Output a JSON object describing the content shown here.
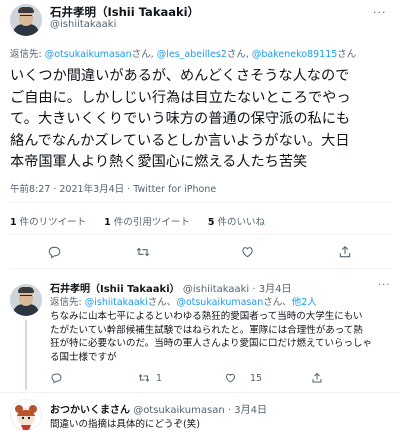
{
  "main_tweet": {
    "author_name": "石井孝明（Ishii Takaaki）",
    "author_handle": "@ishiitakaaki",
    "replying_prefix": "返信先: ",
    "replying_to": [
      "@otsukaikumasan",
      "@les_abeilles2",
      "@bakeneko89115"
    ],
    "replying_sep": "さん, ",
    "replying_suffix": "さん",
    "text": "いくつか間違いがあるが、めんどくさそうな人なので\nご自由に。しかしじい行為は目立たないところでやっ\nて。大きいくくりでいう味方の普通の保守派の私にも\n絡んでなんかズレているとしか言いようがない。大日\n本帝国軍人より熱く愛国心に燃える人たち苦笑",
    "time": "午前8:27 · 2021年3月4日 · Twitter for iPhone",
    "stats": [
      {
        "count": "1",
        "label": "件のリツイート"
      },
      {
        "count": "1",
        "label": "件の引用ツイート"
      },
      {
        "count": "5",
        "label": "件のいいね"
      }
    ]
  },
  "reply_1": {
    "author_name": "石井孝明（Ishii Takaaki）",
    "author_handle": "@ishiitakaaki",
    "date": "· 3月4日",
    "replying_prefix": "返信先: ",
    "replying_to_a": "@ishiitakaaki",
    "replying_mid": "さん、",
    "replying_to_b": "@otsukaikumasan",
    "replying_mid2": "さん、",
    "replying_others": "他2人",
    "text": "ちなみに山本七平によるといわゆる熱狂的愛国者って当時の大学生にもい\nたがたいてい幹部候補生試験ではねられたと。軍隊には合理性があって熱\n狂が特に必要ないのだ。当時の軍人さんより愛国に口だけ燃えていらっしゃ\nる国士様ですが",
    "retweets": "1",
    "likes": "15"
  },
  "reply_2": {
    "author_name": "おつかいくまさん",
    "author_handle": "@otsukaikumasan",
    "date": "· 3月4日",
    "text": "間違いの指摘は具体的にどうぞ(笑)"
  }
}
